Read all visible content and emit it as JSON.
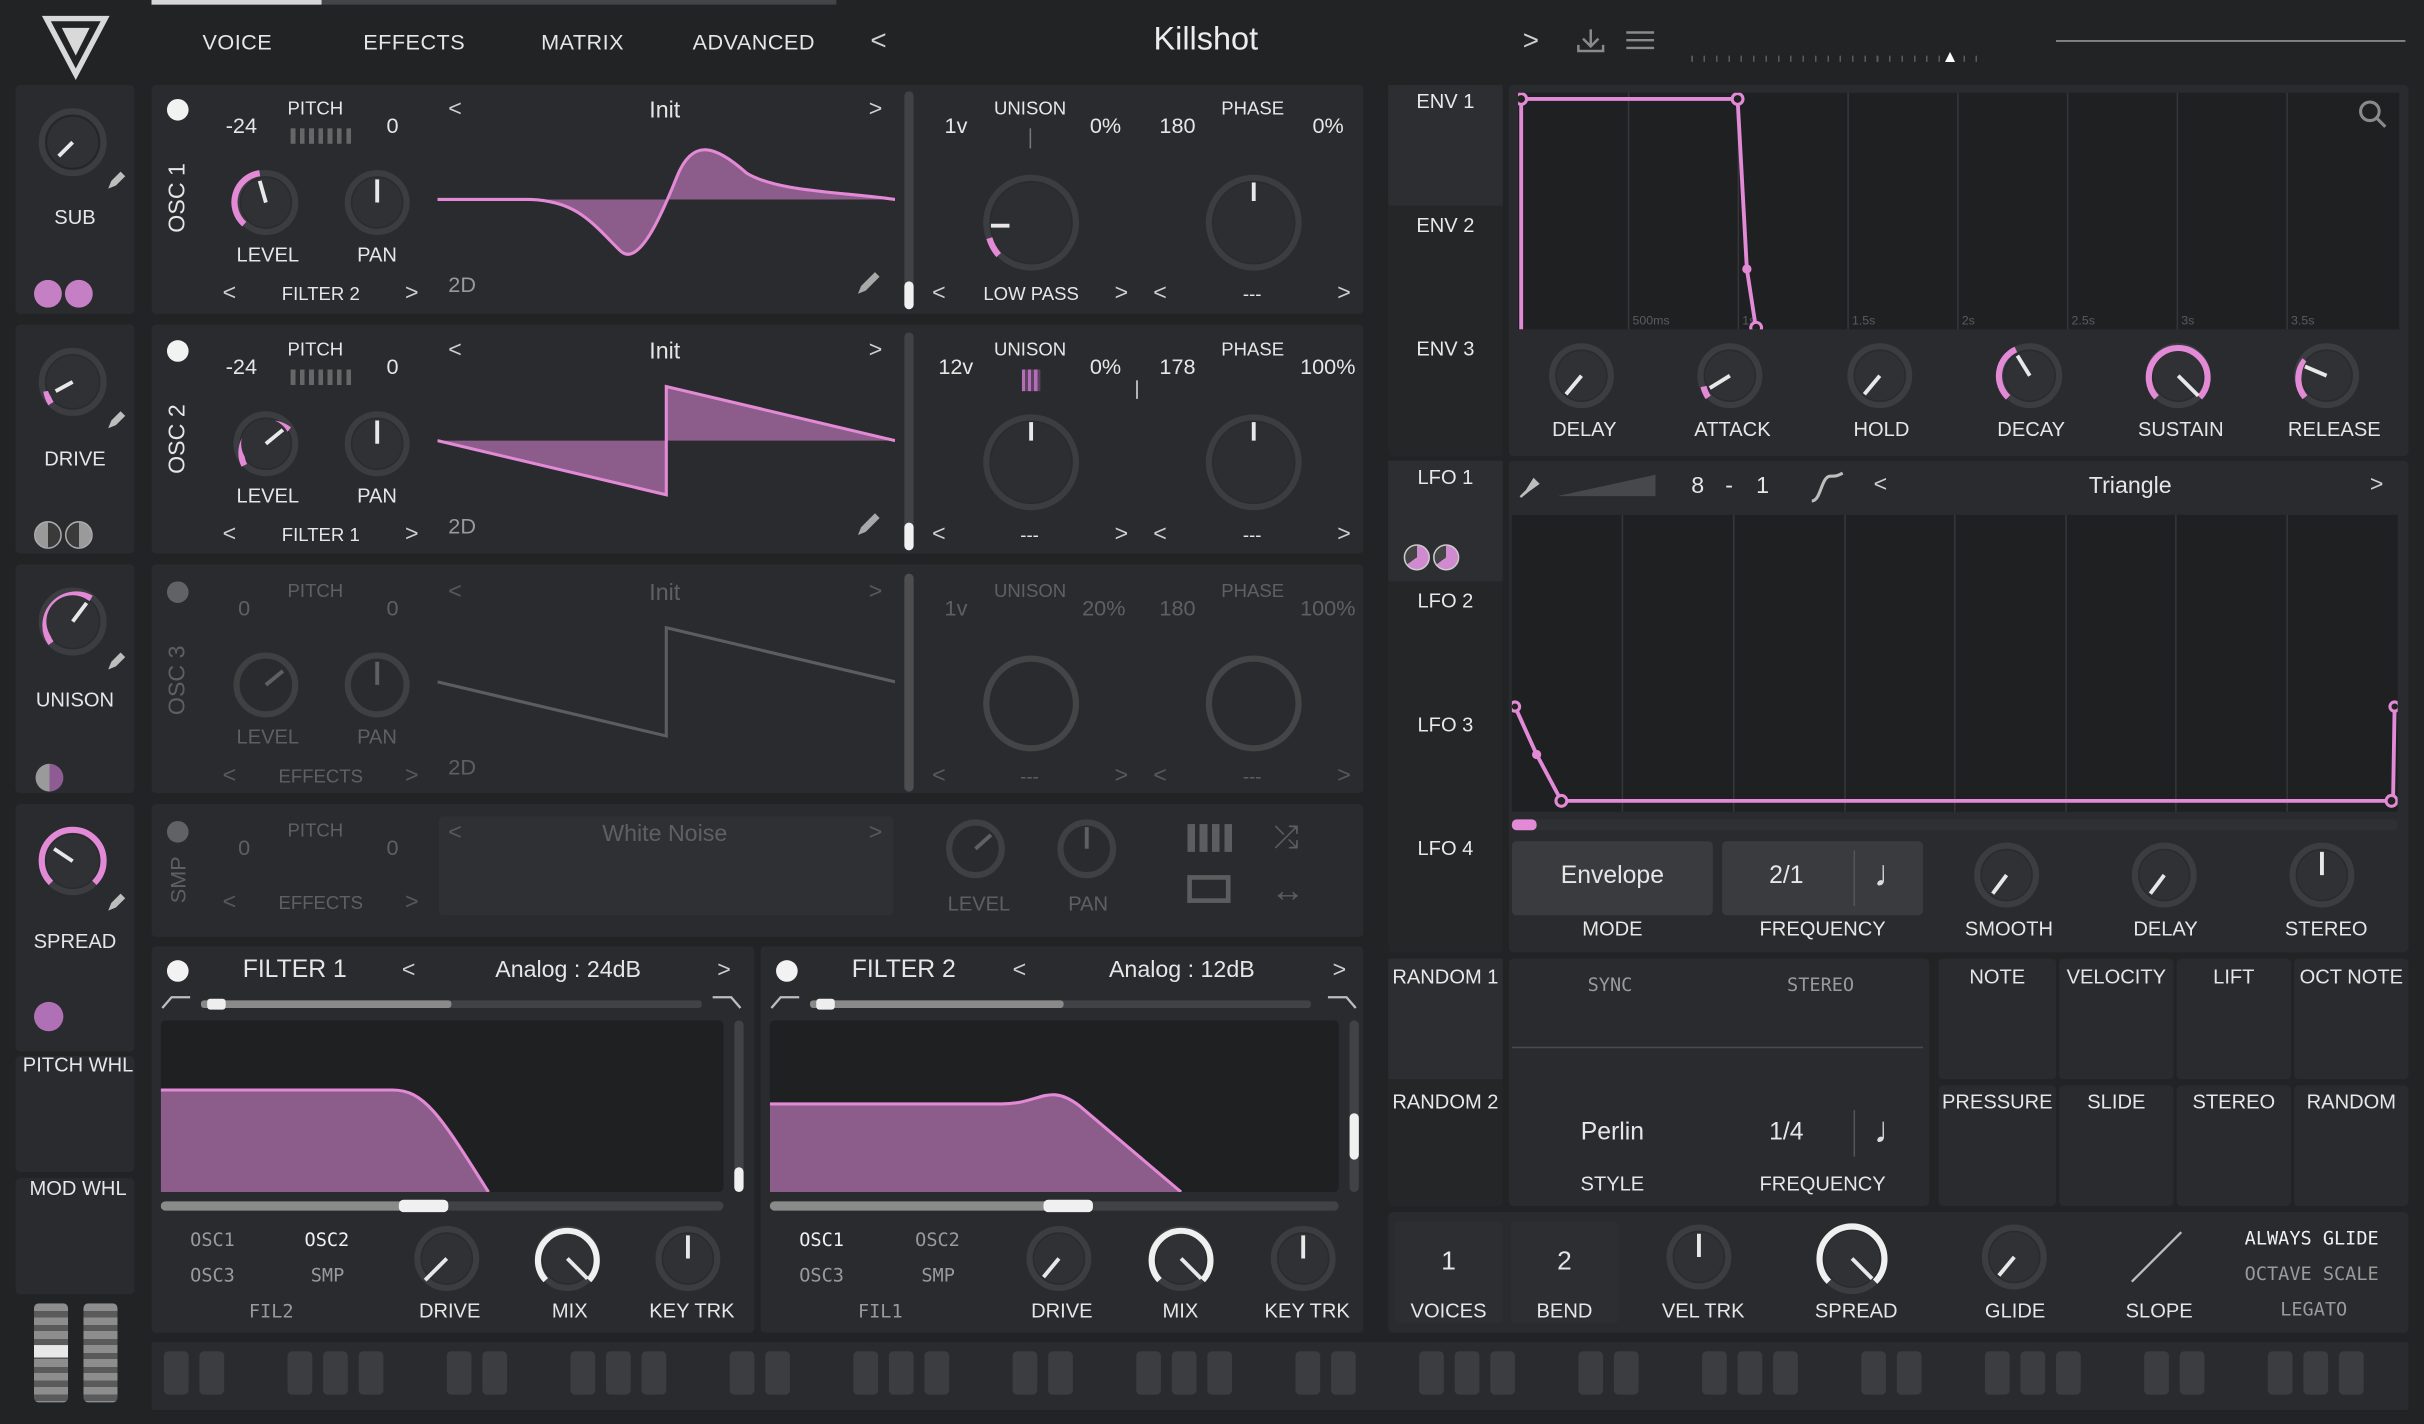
{
  "nav": {
    "tabs": [
      "VOICE",
      "EFFECTS",
      "MATRIX",
      "ADVANCED"
    ],
    "preset_name": "Killshot"
  },
  "macros": [
    {
      "label": "SUB"
    },
    {
      "label": "DRIVE"
    },
    {
      "label": "UNISON"
    },
    {
      "label": "SPREAD"
    }
  ],
  "wheels": {
    "pitch": "PITCH WHL",
    "mod": "MOD WHL"
  },
  "osc1": {
    "name": "OSC 1",
    "pitch_label": "PITCH",
    "pitch_left": "-24",
    "pitch_right": "0",
    "level": "LEVEL",
    "pan": "PAN",
    "route": "FILTER 2",
    "wavetable": "Init",
    "dim": "2D",
    "unison_label": "UNISON",
    "voices": "1v",
    "detune": "0%",
    "phase_label": "PHASE",
    "phase": "180",
    "phase_rand": "0%",
    "filter_type": "LOW PASS",
    "phase_opt": "---"
  },
  "osc2": {
    "name": "OSC 2",
    "pitch_label": "PITCH",
    "pitch_left": "-24",
    "pitch_right": "0",
    "level": "LEVEL",
    "pan": "PAN",
    "route": "FILTER 1",
    "wavetable": "Init",
    "dim": "2D",
    "unison_label": "UNISON",
    "voices": "12v",
    "detune": "0%",
    "phase_label": "PHASE",
    "phase": "178",
    "phase_rand": "100%",
    "filter_type": "---",
    "phase_opt": "---"
  },
  "osc3": {
    "name": "OSC 3",
    "pitch_label": "PITCH",
    "pitch_left": "0",
    "pitch_right": "0",
    "level": "LEVEL",
    "pan": "PAN",
    "route": "EFFECTS",
    "wavetable": "Init",
    "dim": "2D",
    "unison_label": "UNISON",
    "voices": "1v",
    "detune": "20%",
    "phase_label": "PHASE",
    "phase": "180",
    "phase_rand": "100%",
    "filter_type": "---",
    "phase_opt": "---"
  },
  "smp": {
    "name": "SMP",
    "pitch_label": "PITCH",
    "pitch_left": "0",
    "pitch_right": "0",
    "route": "EFFECTS",
    "sample": "White Noise",
    "level": "LEVEL",
    "pan": "PAN"
  },
  "filter1": {
    "name": "FILTER 1",
    "model": "Analog",
    "slope": "24dB",
    "src": [
      "OSC1",
      "OSC2",
      "OSC3",
      "SMP"
    ],
    "fil": "FIL2",
    "drive": "DRIVE",
    "mix": "MIX",
    "keytrk": "KEY TRK"
  },
  "filter2": {
    "name": "FILTER 2",
    "model": "Analog",
    "slope": "12dB",
    "src": [
      "OSC1",
      "OSC2",
      "OSC3",
      "SMP"
    ],
    "fil": "FIL1",
    "drive": "DRIVE",
    "mix": "MIX",
    "keytrk": "KEY TRK"
  },
  "env_tabs": [
    "ENV 1",
    "ENV 2",
    "ENV 3"
  ],
  "env_grid": [
    "500ms",
    "1s",
    "1.5s",
    "2s",
    "2.5s",
    "3s",
    "3.5s"
  ],
  "env_knobs": [
    "DELAY",
    "ATTACK",
    "HOLD",
    "DECAY",
    "SUSTAIN",
    "RELEASE"
  ],
  "lfo_tabs": [
    "LFO 1",
    "LFO 2",
    "LFO 3",
    "LFO 4"
  ],
  "lfo": {
    "grid_x": "8",
    "dash": "-",
    "grid_y": "1",
    "shape": "Triangle",
    "mode_val": "Envelope",
    "mode": "MODE",
    "freq_val": "2/1",
    "freq": "FREQUENCY",
    "smooth": "SMOOTH",
    "delay": "DELAY",
    "stereo": "STEREO"
  },
  "random_tabs": [
    "RANDOM 1",
    "RANDOM 2"
  ],
  "random": {
    "sync": "SYNC",
    "stereo": "STEREO",
    "style_val": "Perlin",
    "style": "STYLE",
    "freq_val": "1/4",
    "freq": "FREQUENCY"
  },
  "mod_sources": [
    "NOTE",
    "VELOCITY",
    "LIFT",
    "OCT NOTE",
    "PRESSURE",
    "SLIDE",
    "STEREO",
    "RANDOM"
  ],
  "voice": {
    "voices_val": "1",
    "voices": "VOICES",
    "bend_val": "2",
    "bend": "BEND",
    "veltrk": "VEL TRK",
    "spread": "SPREAD",
    "glide": "GLIDE",
    "slope": "SLOPE",
    "opts": [
      "ALWAYS GLIDE",
      "OCTAVE SCALE",
      "LEGATO"
    ]
  },
  "colors": {
    "accent": "#e28ad6",
    "bg": "#222325",
    "panel": "#2a2b2e"
  }
}
